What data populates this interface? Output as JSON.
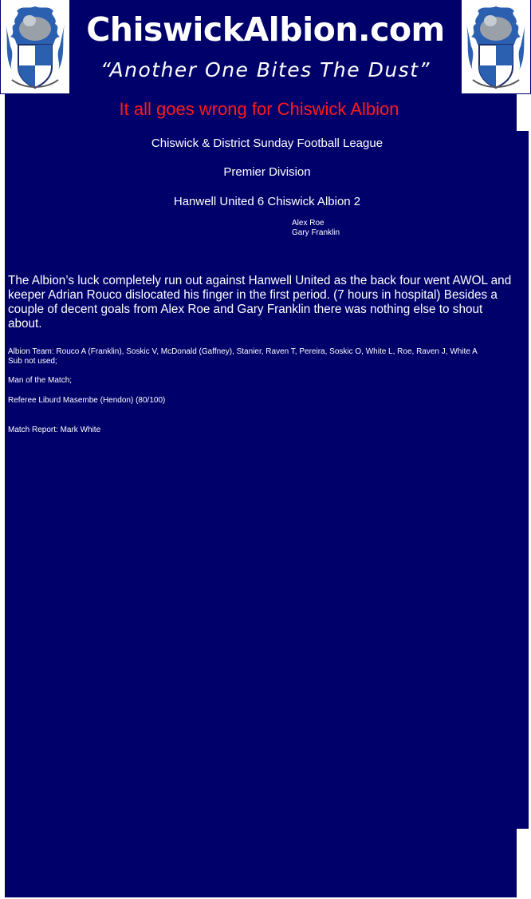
{
  "header": {
    "site_title": "ChiswickAlbion.com",
    "tagline": "“Another One Bites The Dust”",
    "crest_icon": "club-crest-icon"
  },
  "colors": {
    "panel": "#00006b",
    "headline": "#ff1a1a",
    "text": "#ffffff"
  },
  "report": {
    "headline": "It all goes wrong for Chiswick Albion",
    "league": "Chiswick & District Sunday Football League",
    "division": "Premier Division",
    "result": "Hanwell United 6 Chiswick Albion 2",
    "scorers": [
      "Alex Roe",
      "Gary Franklin"
    ],
    "body": "The Albion’s luck completely run out against Hanwell United as the back four went AWOL and keeper Adrian Rouco dislocated his finger in the first period. (7 hours in hospital) Besides a couple of decent goals from Alex Roe and Gary Franklin there was nothing else to shout about.",
    "team_line": "Albion Team: Rouco A (Franklin), Soskic V, McDonald (Gaffney), Stanier, Raven T, Pereira, Soskic O, White L, Roe, Raven J, White A",
    "subs_line": "Sub not used;",
    "motm": "Man of the Match;",
    "referee": "Referee  Liburd Masembe (Hendon) (80/100)",
    "reporter": "Match Report: Mark White"
  }
}
